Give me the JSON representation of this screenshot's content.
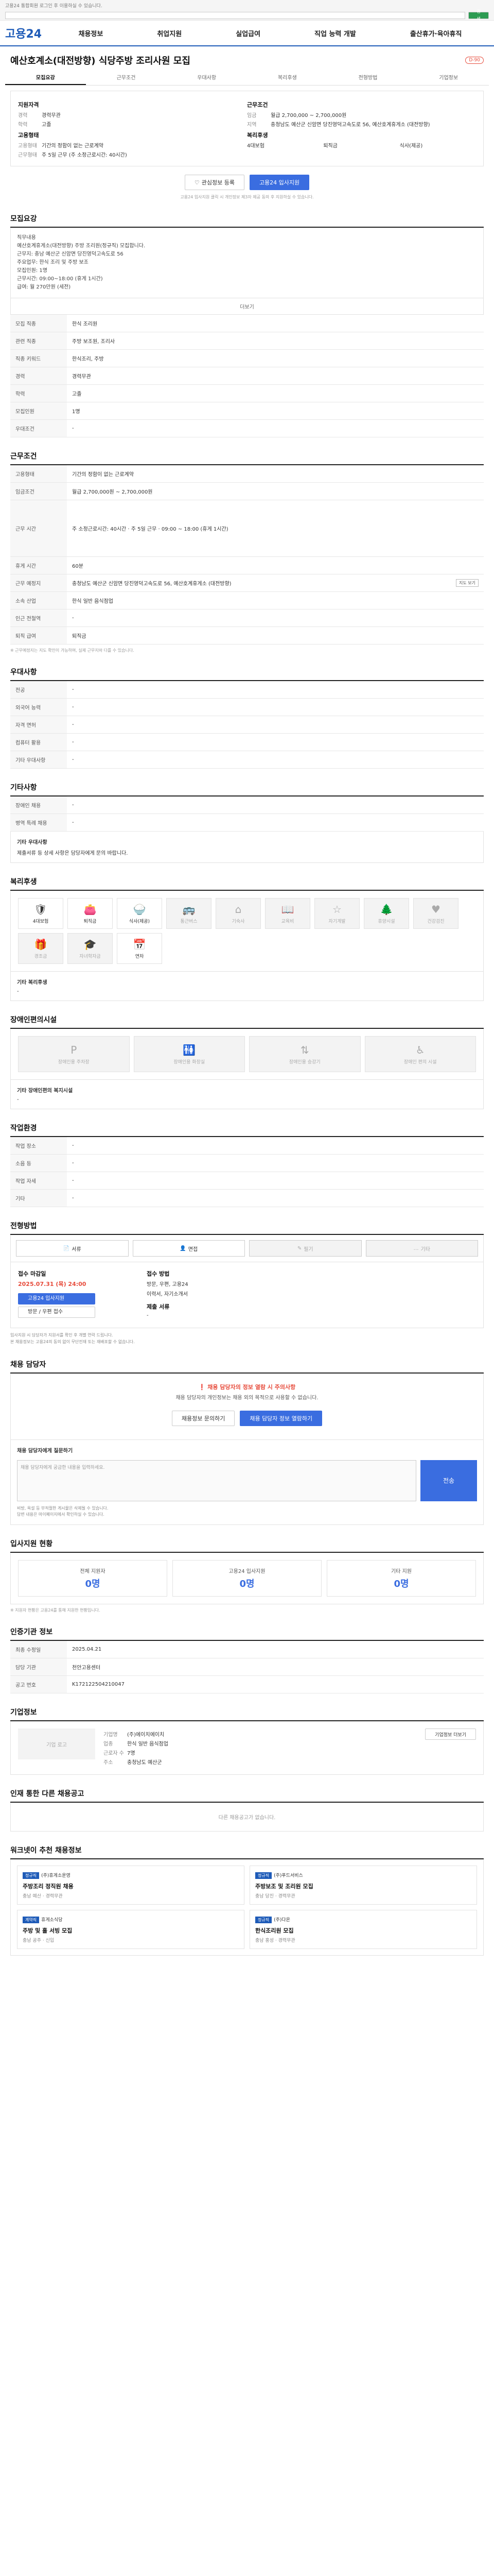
{
  "topbar": {
    "notice": "고용24 통합회원 로그인 후 이용하실 수 있습니다.",
    "search_button": "검색",
    "links": [
      "로그인",
      "회원가입",
      "ENG"
    ]
  },
  "gnb": {
    "logo": "고용24",
    "menu": [
      "채용정보",
      "취업지원",
      "실업급여",
      "직업 능력 개발",
      "출산휴가·육아휴직"
    ]
  },
  "job": {
    "title": "예산호계소(대전방향) 식당주방 조리사원 모집",
    "dday": "D-90",
    "tabs": [
      "모집요강",
      "근무조건",
      "우대사항",
      "복리후생",
      "전형방법",
      "기업정보"
    ],
    "summary": {
      "left_heading": "지원자격",
      "left": [
        {
          "k": "경력",
          "v": "경력무관"
        },
        {
          "k": "학력",
          "v": "고졸"
        }
      ],
      "left_heading2": "고용형태",
      "left2": [
        {
          "k": "고용형태",
          "v": "기간의 정함이 없는 근로계약"
        },
        {
          "k": "근무형태",
          "v": "주 5일 근무 (주 소정근로시간: 40시간)"
        }
      ],
      "right_heading": "근무조건",
      "right": [
        {
          "k": "임금",
          "v": "월급 2,700,000 ~ 2,700,000원"
        },
        {
          "k": "지역",
          "v": "충청남도 예산군 신암면 당진영덕고속도로 56, 예산호계휴게소 (대전방향)"
        }
      ],
      "right_heading2": "복리후생",
      "right_tags": [
        "4대보험",
        "퇴직금",
        "식사(제공)"
      ],
      "buttons": {
        "interest": "관심정보 등록",
        "apply": "고용24 입사지원"
      },
      "note": "고용24 입사지원 클릭 시 개인정보 제3자 제공 동의 후 지원하실 수 있습니다."
    }
  },
  "recruit": {
    "heading": "모집요강",
    "body": [
      "직무내용",
      "예산호계휴게소(대전방향) 주방 조리원(정규직) 모집합니다.",
      "근무지: 충남 예산군 신암면 당진영덕고속도로 56",
      "주요업무: 한식 조리 및 주방 보조",
      "모집인원: 1명",
      "근무시간: 09:00~18:00 (휴게 1시간)",
      "급여: 월 270만원 (세전)"
    ],
    "more": "더보기",
    "table": [
      {
        "k": "모집 직종",
        "v": "한식 조리원"
      },
      {
        "k": "관련 직종",
        "v": "주방 보조원, 조리사"
      },
      {
        "k": "직종 키워드",
        "v": "한식조리, 주방"
      },
      {
        "k": "경력",
        "v": "경력무관"
      },
      {
        "k": "학력",
        "v": "고졸"
      },
      {
        "k": "모집인원",
        "v": "1명"
      },
      {
        "k": "우대조건",
        "v": "-"
      }
    ]
  },
  "conditions": {
    "heading": "근무조건",
    "table": [
      {
        "k": "고용형태",
        "v": "기간의 정함이 없는 근로계약"
      },
      {
        "k": "임금조건",
        "v": "월급 2,700,000원 ~ 2,700,000원"
      },
      {
        "k": "근무 시간",
        "v": "주 소정근로시간: 40시간 · 주 5일 근무 · 09:00 ~ 18:00 (휴게 1시간)"
      },
      {
        "k": "휴게 시간",
        "v": "60분"
      },
      {
        "k": "근무 예정지",
        "v": "충청남도 예산군 신암면 당진영덕고속도로 56, 예산호계휴게소 (대전방향)"
      },
      {
        "k": "소속 산업",
        "v": "한식 일반 음식점업"
      },
      {
        "k": "인근 전철역",
        "v": "-"
      },
      {
        "k": "퇴직 급여",
        "v": "퇴직금"
      }
    ],
    "map_button": "지도 보기",
    "note": "※ 근무예정지는 지도 확인이 가능하며, 실제 근무지와 다를 수 있습니다."
  },
  "preference": {
    "heading": "우대사항",
    "table": [
      {
        "k": "전공",
        "v": "-"
      },
      {
        "k": "외국어 능력",
        "v": "-"
      },
      {
        "k": "자격 면허",
        "v": "-"
      },
      {
        "k": "컴퓨터 활용",
        "v": "-"
      },
      {
        "k": "기타 우대사항",
        "v": "-"
      }
    ]
  },
  "extra": {
    "heading": "기타사항",
    "table": [
      {
        "k": "장애인 채용",
        "v": "-"
      },
      {
        "k": "병역 특례 채용",
        "v": "-"
      }
    ],
    "note_title": "기타 우대사항",
    "note": "제출서류 등 상세 사항은 담당자에게 문의 바랍니다."
  },
  "welfare": {
    "heading": "복리후생",
    "tiles": [
      {
        "label": "4대보험",
        "icon": "shield-icon",
        "on": true
      },
      {
        "label": "퇴직금",
        "icon": "wallet-icon",
        "on": true
      },
      {
        "label": "식사(제공)",
        "icon": "meal-icon",
        "on": true
      },
      {
        "label": "통근버스",
        "icon": "bus-icon",
        "on": false
      },
      {
        "label": "기숙사",
        "icon": "house-icon",
        "on": false
      },
      {
        "label": "교육비",
        "icon": "book-icon",
        "on": false
      },
      {
        "label": "자기계발",
        "icon": "star-icon",
        "on": false
      },
      {
        "label": "휴양시설",
        "icon": "tree-icon",
        "on": false
      },
      {
        "label": "건강검진",
        "icon": "heart-icon",
        "on": false
      },
      {
        "label": "경조금",
        "icon": "gift-icon",
        "on": false
      },
      {
        "label": "자녀학자금",
        "icon": "cap-icon",
        "on": false
      },
      {
        "label": "연차",
        "icon": "calendar-icon",
        "on": true
      }
    ],
    "other_title": "기타 복리후생",
    "other": "-"
  },
  "accessibility": {
    "heading": "장애인편의시설",
    "tiles": [
      "장애인용 주차장",
      "장애인용 화장실",
      "장애인용 승강기",
      "장애인 편의 시설"
    ],
    "other_title": "기타 장애인편의 복지시설",
    "other": "-"
  },
  "env": {
    "heading": "작업환경",
    "table": [
      {
        "k": "작업 장소",
        "v": "-"
      },
      {
        "k": "소음 등",
        "v": "-"
      },
      {
        "k": "작업 자세",
        "v": "-"
      },
      {
        "k": "기타",
        "v": "-"
      }
    ]
  },
  "apply": {
    "heading": "전형방법",
    "methods": [
      {
        "label": "서류",
        "on": true
      },
      {
        "label": "면접",
        "on": true
      },
      {
        "label": "필기",
        "on": false
      },
      {
        "label": "기타",
        "on": false
      }
    ],
    "deadline_label": "접수 마감일",
    "deadline": "2025.07.31 (목) 24:00",
    "apply_button": "고용24 입사지원",
    "direct_button": "방문 / 우편 접수",
    "doc_label": "접수 방법",
    "doc": "방문, 우편, 고용24",
    "doc2": "이력서, 자기소개서",
    "submit_label": "제출 서류",
    "submit": "-",
    "bullets": [
      "입사지원 시 담당자가 지원서를 확인 후 개별 연락 드립니다.",
      "본 채용정보는 고용24의 동의 없이 무단전재 또는 재배포할 수 없습니다."
    ]
  },
  "inquiry": {
    "heading": "채용 담당자",
    "warning": "채용 담당자의 정보 열람 시 주의사항",
    "text": "채용 담당자의 개인정보는 채용 외의 목적으로 사용할 수 없습니다.",
    "btn1": "채용정보 문의하기",
    "btn2": "채용 담당자 정보 열람하기",
    "ask_title": "채용 담당자에게 질문하기",
    "ask_placeholder": "채용 담당자에게 궁금한 내용을 입력하세요.",
    "send": "전송",
    "bullets": [
      "비방, 욕설 등 부적절한 게시물은 삭제될 수 있습니다.",
      "답변 내용은 마이페이지에서 확인하실 수 있습니다."
    ]
  },
  "status": {
    "heading": "입사지원 현황",
    "items": [
      {
        "label": "전체 지원자",
        "value": "0명"
      },
      {
        "label": "고용24 입사지원",
        "value": "0명"
      },
      {
        "label": "기타 지원",
        "value": "0명"
      }
    ],
    "note": "※ 지원자 현황은 고용24를 통해 지원한 현황입니다."
  },
  "agency": {
    "heading": "인증기관 정보",
    "table": [
      {
        "k": "최종 수정일",
        "v": "2025.04.21"
      },
      {
        "k": "담당 기관",
        "v": "천안고용센터"
      },
      {
        "k": "공고 번호",
        "v": "K172122504210047"
      }
    ]
  },
  "company": {
    "heading": "기업정보",
    "logo": "기업 로고",
    "rows": [
      {
        "k": "기업명",
        "v": "(주)에이치에이치"
      },
      {
        "k": "업종",
        "v": "한식 일반 음식점업"
      },
      {
        "k": "근로자 수",
        "v": "7명"
      },
      {
        "k": "주소",
        "v": "충청남도 예산군"
      }
    ],
    "btn": "기업정보 더보기"
  },
  "similar": {
    "heading": "인재 통한 다른 채용공고",
    "empty": "다른 채용공고가 없습니다."
  },
  "recommend": {
    "heading": "워크넷이 추천 채용정보",
    "items": [
      {
        "tag": "정규직",
        "org": "(주)휴게소운영",
        "title": "주방조리 정직원 채용",
        "meta": "충남 예산 · 경력무관"
      },
      {
        "tag": "정규직",
        "org": "(주)푸드서비스",
        "title": "주방보조 및 조리원 모집",
        "meta": "충남 당진 · 경력무관"
      },
      {
        "tag": "계약직",
        "org": "휴게소식당",
        "title": "주방 및 홀 서빙 모집",
        "meta": "충남 공주 · 신입"
      },
      {
        "tag": "정규직",
        "org": "(주)다온",
        "title": "한식조리원 모집",
        "meta": "충남 홍성 · 경력무관"
      }
    ]
  }
}
